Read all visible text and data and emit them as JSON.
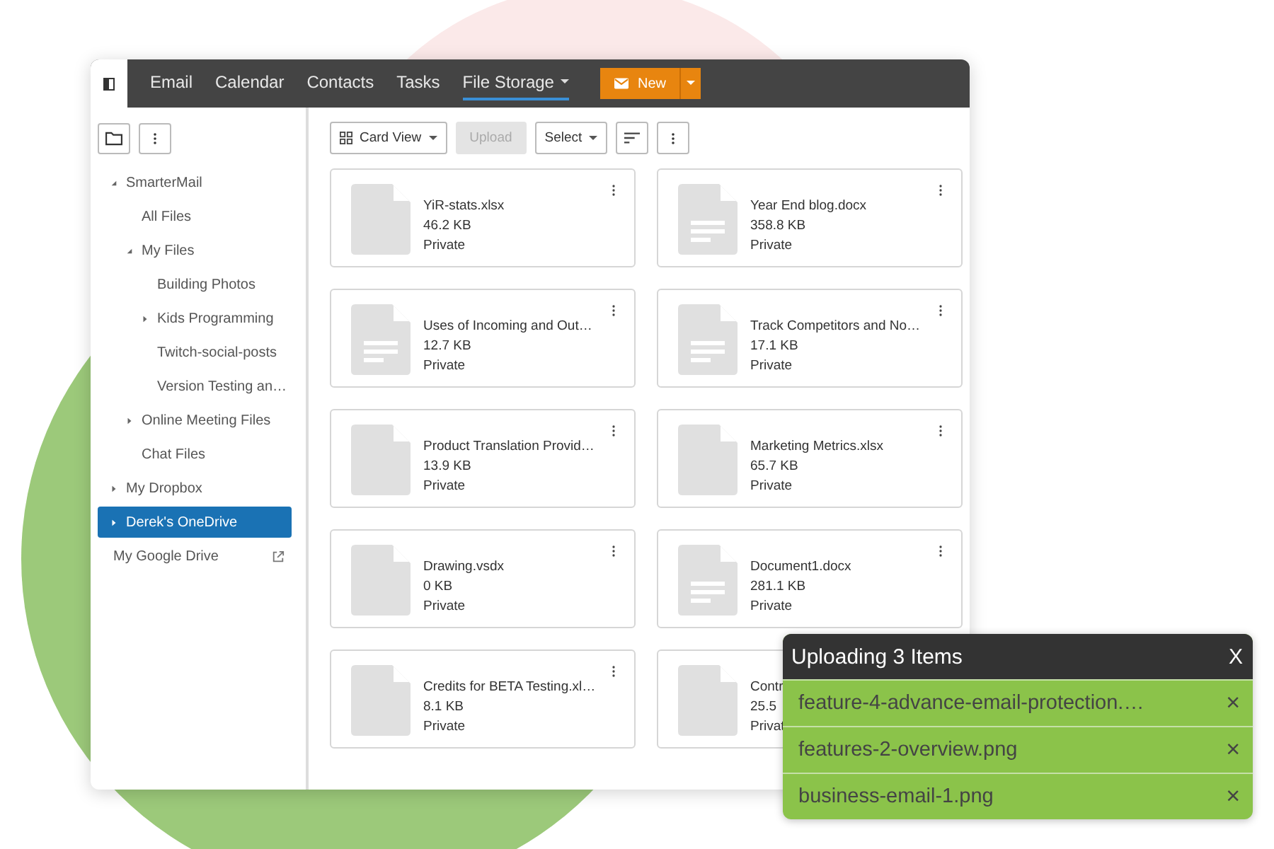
{
  "nav": {
    "tabs": [
      {
        "label": "Email",
        "selected": false,
        "dropdown": false
      },
      {
        "label": "Calendar",
        "selected": false,
        "dropdown": false
      },
      {
        "label": "Contacts",
        "selected": false,
        "dropdown": false
      },
      {
        "label": "Tasks",
        "selected": false,
        "dropdown": false
      },
      {
        "label": "File Storage",
        "selected": true,
        "dropdown": true
      }
    ],
    "new_button": "New"
  },
  "sidebar": {
    "items": [
      {
        "label": "SmarterMail",
        "expanded": true,
        "selected": false,
        "children": [
          {
            "label": "All Files",
            "selected": false
          },
          {
            "label": "My Files",
            "expanded": true,
            "selected": false,
            "children": [
              {
                "label": "Building Photos",
                "selected": false
              },
              {
                "label": "Kids Programming",
                "expanded": false,
                "selected": false
              },
              {
                "label": "Twitch-social-posts",
                "selected": false
              },
              {
                "label": "Version Testing an…",
                "selected": false
              }
            ]
          },
          {
            "label": "Online Meeting Files",
            "expanded": false,
            "selected": false
          },
          {
            "label": "Chat Files",
            "selected": false
          }
        ]
      },
      {
        "label": "My Dropbox",
        "expanded": false,
        "selected": false
      },
      {
        "label": "Derek's OneDrive",
        "expanded": false,
        "selected": true
      },
      {
        "label": "My Google Drive",
        "selected": false,
        "external": true
      }
    ]
  },
  "toolbar": {
    "buttons": [
      {
        "kind": "view",
        "label": "Card View",
        "disabled": false
      },
      {
        "kind": "plain",
        "label": "Upload",
        "disabled": true
      },
      {
        "kind": "dropdown",
        "label": "Select",
        "disabled": false
      },
      {
        "kind": "sort",
        "disabled": false
      },
      {
        "kind": "more",
        "disabled": false
      }
    ]
  },
  "files": [
    {
      "name": "YiR-stats.xlsx",
      "size": "46.2 KB",
      "sharing": "Private",
      "kind": "blank"
    },
    {
      "name": "Year End blog.docx",
      "size": "358.8 KB",
      "sharing": "Private",
      "kind": "text"
    },
    {
      "name": "Uses of Incoming and Out…",
      "size": "12.7 KB",
      "sharing": "Private",
      "kind": "text"
    },
    {
      "name": "Track Competitors and No…",
      "size": "17.1 KB",
      "sharing": "Private",
      "kind": "text"
    },
    {
      "name": "Product Translation Provid…",
      "size": "13.9 KB",
      "sharing": "Private",
      "kind": "blank"
    },
    {
      "name": "Marketing Metrics.xlsx",
      "size": "65.7 KB",
      "sharing": "Private",
      "kind": "blank"
    },
    {
      "name": "Drawing.vsdx",
      "size": "0 KB",
      "sharing": "Private",
      "kind": "blank"
    },
    {
      "name": "Document1.docx",
      "size": "281.1 KB",
      "sharing": "Private",
      "kind": "text"
    },
    {
      "name": "Credits for BETA Testing.xl…",
      "size": "8.1 KB",
      "sharing": "Private",
      "kind": "blank"
    },
    {
      "name": "Contr",
      "size": "25.5",
      "sharing": "Privat",
      "kind": "blank"
    }
  ],
  "upload_panel": {
    "title": "Uploading 3 Items",
    "close": "X",
    "items": [
      {
        "name": "feature-4-advance-email-protection.…",
        "remove": "×"
      },
      {
        "name": "features-2-overview.png",
        "remove": "×"
      },
      {
        "name": "business-email-1.png",
        "remove": "×"
      }
    ]
  }
}
